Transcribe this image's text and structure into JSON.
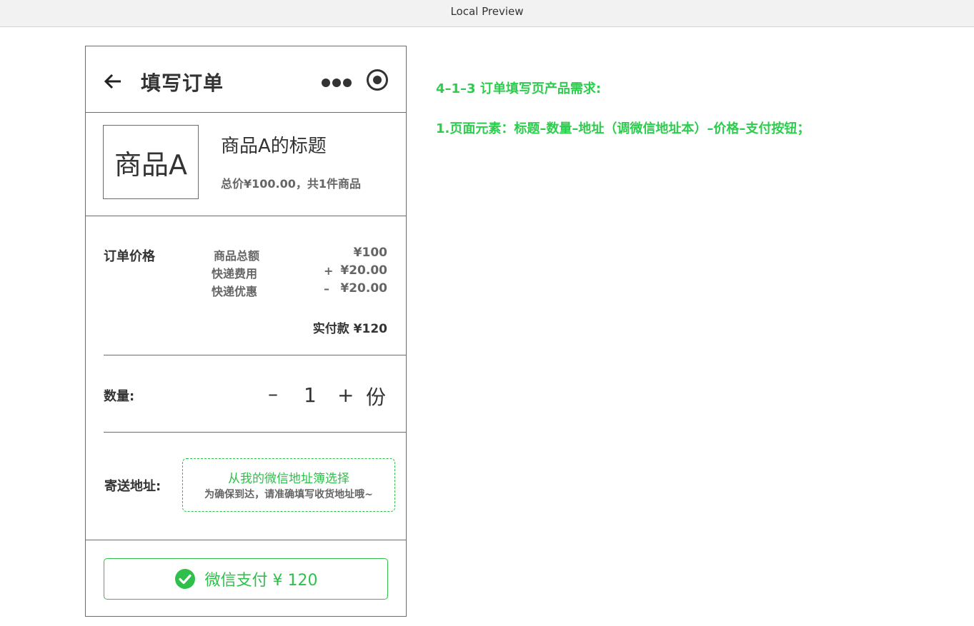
{
  "window": {
    "title": "Local Preview"
  },
  "header": {
    "title": "填写订单"
  },
  "product": {
    "image_label": "商品A",
    "title": "商品A的标题",
    "subtitle": "总价¥100.00，共1件商品"
  },
  "order_price": {
    "label": "订单价格",
    "rows": [
      {
        "label": "商品总额",
        "sign": "",
        "value": "¥100"
      },
      {
        "label": "快递费用",
        "sign": "+",
        "value": "¥20.00"
      },
      {
        "label": "快递优惠",
        "sign": "–",
        "value": "¥20.00"
      }
    ],
    "total": "实付款 ¥120"
  },
  "quantity": {
    "label": "数量:",
    "minus": "–",
    "value": "1",
    "plus": "+",
    "unit": "份"
  },
  "address": {
    "label": "寄送地址:",
    "link": "从我的微信地址簿选择",
    "hint": "为确保到达，请准确填写收货地址哦~"
  },
  "pay": {
    "label": "微信支付 ¥ 120",
    "accent": "#2fbf4a"
  },
  "notes": {
    "heading": "4–1–3  订单填写页产品需求:",
    "item1": "1.页面元素：标题–数量–地址（调微信地址本）–价格–支付按钮；"
  }
}
